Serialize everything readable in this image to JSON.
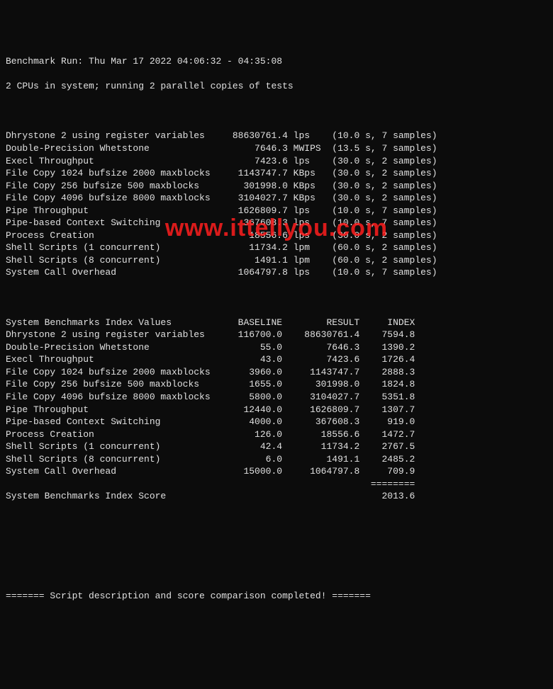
{
  "header": {
    "run_line": "Benchmark Run: Thu Mar 17 2022 04:06:32 - 04:35:08",
    "cpu_line": "2 CPUs in system; running 2 parallel copies of tests"
  },
  "results": [
    {
      "name": "Dhrystone 2 using register variables",
      "value": "88630761.4",
      "unit": "lps",
      "time": "10.0",
      "samples": "7"
    },
    {
      "name": "Double-Precision Whetstone",
      "value": "7646.3",
      "unit": "MWIPS",
      "time": "13.5",
      "samples": "7"
    },
    {
      "name": "Execl Throughput",
      "value": "7423.6",
      "unit": "lps",
      "time": "30.0",
      "samples": "2"
    },
    {
      "name": "File Copy 1024 bufsize 2000 maxblocks",
      "value": "1143747.7",
      "unit": "KBps",
      "time": "30.0",
      "samples": "2"
    },
    {
      "name": "File Copy 256 bufsize 500 maxblocks",
      "value": "301998.0",
      "unit": "KBps",
      "time": "30.0",
      "samples": "2"
    },
    {
      "name": "File Copy 4096 bufsize 8000 maxblocks",
      "value": "3104027.7",
      "unit": "KBps",
      "time": "30.0",
      "samples": "2"
    },
    {
      "name": "Pipe Throughput",
      "value": "1626809.7",
      "unit": "lps",
      "time": "10.0",
      "samples": "7"
    },
    {
      "name": "Pipe-based Context Switching",
      "value": "367608.3",
      "unit": "lps",
      "time": "10.0",
      "samples": "7"
    },
    {
      "name": "Process Creation",
      "value": "18556.6",
      "unit": "lps",
      "time": "30.0",
      "samples": "2"
    },
    {
      "name": "Shell Scripts (1 concurrent)",
      "value": "11734.2",
      "unit": "lpm",
      "time": "60.0",
      "samples": "2"
    },
    {
      "name": "Shell Scripts (8 concurrent)",
      "value": "1491.1",
      "unit": "lpm",
      "time": "60.0",
      "samples": "2"
    },
    {
      "name": "System Call Overhead",
      "value": "1064797.8",
      "unit": "lps",
      "time": "10.0",
      "samples": "7"
    }
  ],
  "index": {
    "header": {
      "label": "System Benchmarks Index Values",
      "baseline": "BASELINE",
      "result": "RESULT",
      "idx": "INDEX"
    },
    "rows": [
      {
        "name": "Dhrystone 2 using register variables",
        "baseline": "116700.0",
        "result": "88630761.4",
        "idx": "7594.8"
      },
      {
        "name": "Double-Precision Whetstone",
        "baseline": "55.0",
        "result": "7646.3",
        "idx": "1390.2"
      },
      {
        "name": "Execl Throughput",
        "baseline": "43.0",
        "result": "7423.6",
        "idx": "1726.4"
      },
      {
        "name": "File Copy 1024 bufsize 2000 maxblocks",
        "baseline": "3960.0",
        "result": "1143747.7",
        "idx": "2888.3"
      },
      {
        "name": "File Copy 256 bufsize 500 maxblocks",
        "baseline": "1655.0",
        "result": "301998.0",
        "idx": "1824.8"
      },
      {
        "name": "File Copy 4096 bufsize 8000 maxblocks",
        "baseline": "5800.0",
        "result": "3104027.7",
        "idx": "5351.8"
      },
      {
        "name": "Pipe Throughput",
        "baseline": "12440.0",
        "result": "1626809.7",
        "idx": "1307.7"
      },
      {
        "name": "Pipe-based Context Switching",
        "baseline": "4000.0",
        "result": "367608.3",
        "idx": "919.0"
      },
      {
        "name": "Process Creation",
        "baseline": "126.0",
        "result": "18556.6",
        "idx": "1472.7"
      },
      {
        "name": "Shell Scripts (1 concurrent)",
        "baseline": "42.4",
        "result": "11734.2",
        "idx": "2767.5"
      },
      {
        "name": "Shell Scripts (8 concurrent)",
        "baseline": "6.0",
        "result": "1491.1",
        "idx": "2485.2"
      },
      {
        "name": "System Call Overhead",
        "baseline": "15000.0",
        "result": "1064797.8",
        "idx": "709.9"
      }
    ],
    "divider": "========",
    "score": {
      "label": "System Benchmarks Index Score",
      "value": "2013.6"
    }
  },
  "footer": "======= Script description and score comparison completed! =======",
  "watermark": "www.ittellyou.com"
}
